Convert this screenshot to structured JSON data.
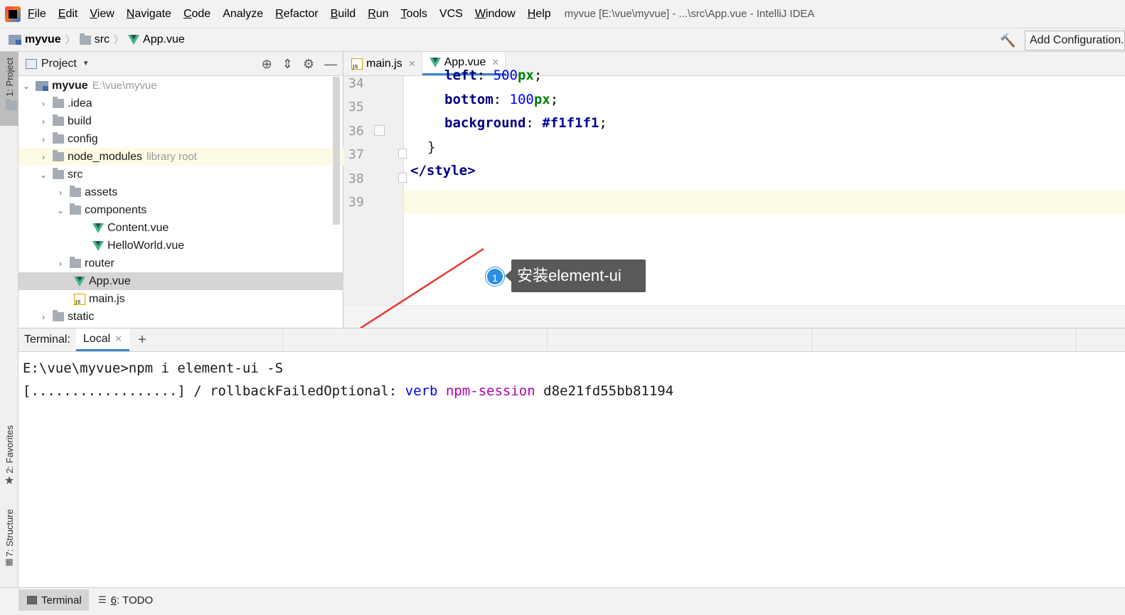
{
  "menu": {
    "items": [
      {
        "label": "File",
        "u": "F",
        "rest": "ile"
      },
      {
        "label": "Edit",
        "u": "E",
        "rest": "dit"
      },
      {
        "label": "View",
        "u": "V",
        "rest": "iew"
      },
      {
        "label": "Navigate",
        "u": "N",
        "rest": "avigate"
      },
      {
        "label": "Code",
        "u": "C",
        "rest": "ode"
      },
      {
        "label": "Analyze",
        "u": "",
        "rest": "Analyze"
      },
      {
        "label": "Refactor",
        "u": "R",
        "rest": "efactor"
      },
      {
        "label": "Build",
        "u": "B",
        "rest": "uild"
      },
      {
        "label": "Run",
        "u": "R",
        "rest": "un"
      },
      {
        "label": "Tools",
        "u": "T",
        "rest": "ools"
      },
      {
        "label": "VCS",
        "u": "",
        "rest": "VCS"
      },
      {
        "label": "Window",
        "u": "W",
        "rest": "indow"
      },
      {
        "label": "Help",
        "u": "H",
        "rest": "elp"
      }
    ],
    "window_title": "myvue [E:\\vue\\myvue] - ...\\src\\App.vue - IntelliJ IDEA"
  },
  "navbar": {
    "crumb_project": "myvue",
    "crumb_src": "src",
    "crumb_file": "App.vue",
    "add_config": "Add Configuration..."
  },
  "left_strip": {
    "project": "1: Project",
    "favorites": "2: Favorites",
    "structure": "7: Structure"
  },
  "project_panel": {
    "title": "Project",
    "root_name": "myvue",
    "root_path": "E:\\vue\\myvue",
    "idea": ".idea",
    "build": "build",
    "config": "config",
    "node_modules": "node_modules",
    "library_root": "library root",
    "src": "src",
    "assets": "assets",
    "components": "components",
    "content_vue": "Content.vue",
    "helloworld_vue": "HelloWorld.vue",
    "router": "router",
    "app_vue": "App.vue",
    "main_js": "main.js",
    "static": "static"
  },
  "editor": {
    "tab_main": "main.js",
    "tab_app": "App.vue",
    "line_numbers": [
      "34",
      "35",
      "36",
      "37",
      "38",
      "39"
    ],
    "l34_prop": "left",
    "l34_num": "500",
    "l34_unit": "px",
    "l35_prop": "bottom",
    "l35_num": "100",
    "l35_unit": "px",
    "l36_prop": "background",
    "l36_val": "#f1f1f1",
    "l37": "}",
    "l38_open": "</",
    "l38_tag": "style",
    "l38_close": ">"
  },
  "annotation": {
    "badge": "1",
    "text": "安装element-ui"
  },
  "terminal": {
    "label": "Terminal:",
    "tab": "Local",
    "plus": "+",
    "line1": "E:\\vue\\myvue>npm i element-ui -S",
    "line2_prefix": "[..................] / rollbackFailedOptional: ",
    "line2_verb": "verb",
    "line2_session": "npm-session",
    "line2_id": "d8e21fd55bb81194"
  },
  "statusbar": {
    "terminal": "Terminal",
    "todo_num": "6",
    "todo_rest": ": TODO"
  },
  "colors": {
    "accent": "#4083c9",
    "arrow": "#e53935",
    "vue_green": "#41b883"
  }
}
